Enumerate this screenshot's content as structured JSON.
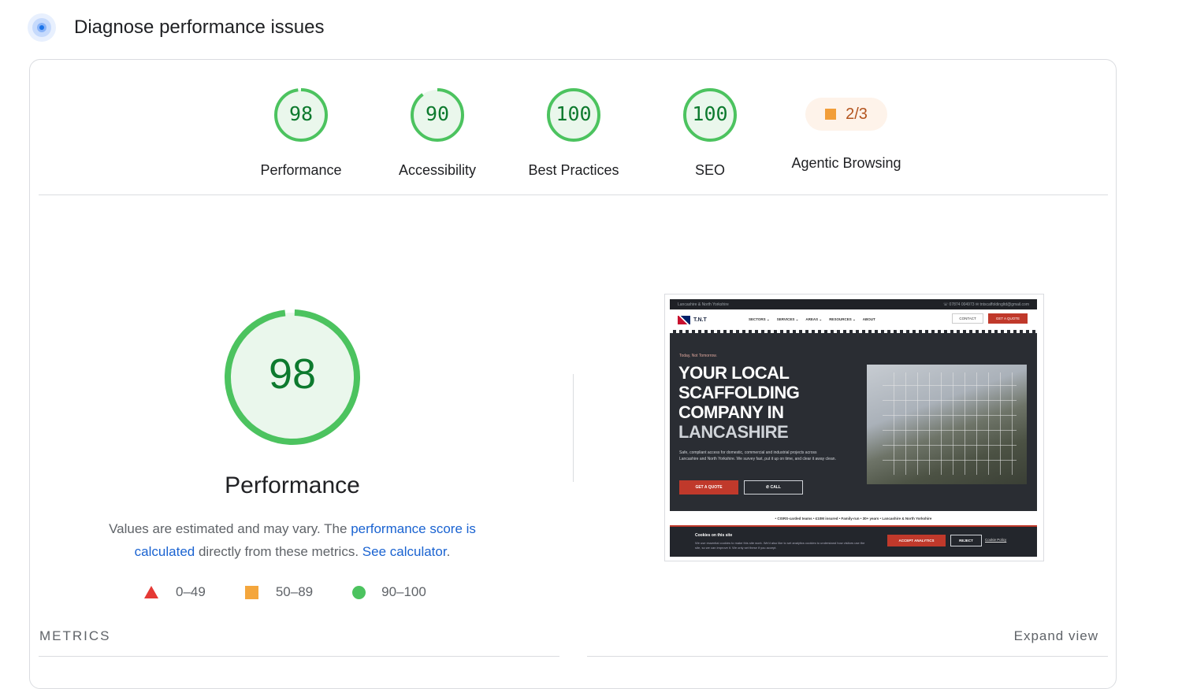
{
  "header": {
    "title": "Diagnose performance issues",
    "logo_icon": "lighthouse-icon"
  },
  "colors": {
    "pass": "#4cc35f",
    "pass_text": "#0d7a2e",
    "average": "#f4a63c",
    "fail": "#e53935",
    "link": "#1a63d1"
  },
  "scores": [
    {
      "value": "98",
      "label": "Performance"
    },
    {
      "value": "90",
      "label": "Accessibility"
    },
    {
      "value": "100",
      "label": "Best Practices"
    },
    {
      "value": "100",
      "label": "SEO"
    }
  ],
  "agentic": {
    "value": "2/3",
    "label": "Agentic Browsing"
  },
  "performance": {
    "score": "98",
    "title": "Performance",
    "desc_prefix": "Values are estimated and may vary. The ",
    "desc_link1": "performance score is calculated",
    "desc_middle": " directly from these metrics. ",
    "desc_link2": "See calculator",
    "desc_suffix": "."
  },
  "legend": [
    {
      "range": "0–49",
      "icon": "red-triangle-icon"
    },
    {
      "range": "50–89",
      "icon": "orange-square-icon"
    },
    {
      "range": "90–100",
      "icon": "green-circle-icon"
    }
  ],
  "metrics": {
    "heading": "METRICS",
    "expand_label": "Expand view"
  },
  "screenshot": {
    "topbar_left": "Lancashire & North Yorkshire",
    "topbar_right": "☏ 07874 004973   ✉ tntscaffoldingltd@gmail.com",
    "brand": "T.N.T",
    "nav": [
      "SECTORS ⌄",
      "SERVICES ⌄",
      "AREAS ⌄",
      "RESOURCES ⌄",
      "ABOUT"
    ],
    "contact": "CONTACT",
    "get_quote": "GET A QUOTE",
    "tagline": "Today, Not Tomorrow.",
    "headline_1": "YOUR LOCAL",
    "headline_2": "SCAFFOLDING",
    "headline_3": "COMPANY IN",
    "headline_4": "LANCASHIRE",
    "subtext": "Safe, compliant access for domestic, commercial and industrial projects across Lancashire and North Yorkshire. We survey fast, put it up on time, and clear it away clean.",
    "btn_quote": "GET A QUOTE",
    "btn_call": "✆ CALL",
    "strip": "• CISRS-carded teams   • £10M insured   • Family-run   • 30+ years   • Lancashire & North Yorkshire",
    "cookie_title": "Cookies on this site",
    "cookie_desc": "We use essential cookies to make this site work. We'd also like to set analytics cookies to understand how visitors use the site, so we can improve it. We only set these if you accept.",
    "accept": "ACCEPT ANALYTICS",
    "reject": "REJECT",
    "policy": "Cookie Policy"
  }
}
